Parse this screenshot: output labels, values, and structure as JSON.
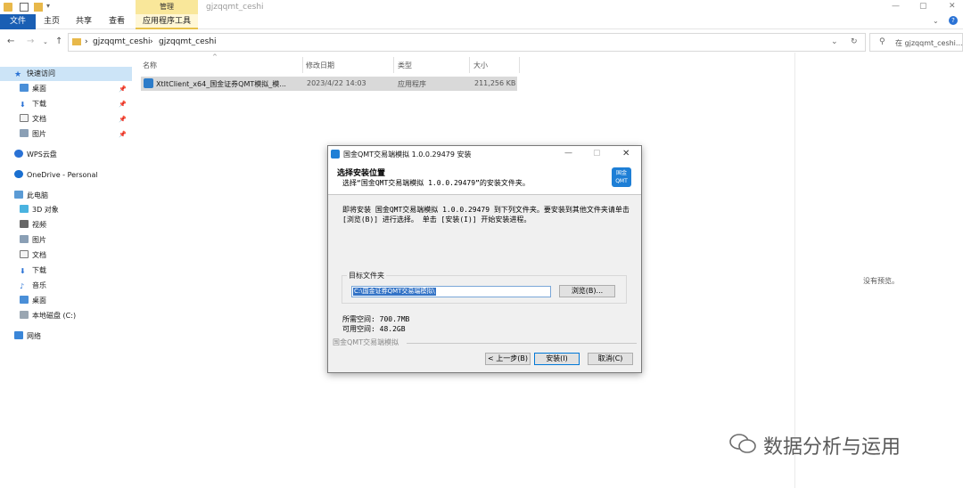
{
  "window": {
    "title": "gjzqqmt_ceshi",
    "tools_group": "管理"
  },
  "ribbon": {
    "tabs": [
      "文件",
      "主页",
      "共享",
      "查看",
      "应用程序工具"
    ]
  },
  "address": {
    "path": [
      "gjzqqmt_ceshi",
      "gjzqqmt_ceshi"
    ],
    "search_placeholder": "在 gjzqqmt_ceshi..."
  },
  "nav": {
    "quick_access": "快速访问",
    "quick_items": [
      "桌面",
      "下载",
      "文档",
      "图片"
    ],
    "wps": "WPS云盘",
    "onedrive": "OneDrive - Personal",
    "this_pc": "此电脑",
    "pc_items": [
      "3D 对象",
      "视频",
      "图片",
      "文档",
      "下载",
      "音乐",
      "桌面",
      "本地磁盘 (C:)"
    ],
    "network": "网络"
  },
  "columns": {
    "name": "名称",
    "date": "修改日期",
    "type": "类型",
    "size": "大小"
  },
  "files": [
    {
      "name": "XtItClient_x64_国金证券QMT模拟_模...",
      "date": "2023/4/22 14:03",
      "type": "应用程序",
      "size": "211,256 KB"
    }
  ],
  "preview": {
    "empty_text": "没有预览。"
  },
  "installer": {
    "title": "国金QMT交易端模拟 1.0.0.29479 安装",
    "heading": "选择安装位置",
    "subheading": "选择“国金QMT交易端模拟 1.0.0.29479”的安装文件夹。",
    "body": "即将安装 国金QMT交易端模拟 1.0.0.29479 到下列文件夹。要安装到其他文件夹请单击 [浏览(B)] 进行选择。 单击 [安装(I)] 开始安装进程。",
    "folder_label": "目标文件夹",
    "folder_path": "C:\\国金证券QMT交易端模拟\\",
    "browse_button": "浏览(B)...",
    "space_required": "所需空间: 700.7MB",
    "space_available": "可用空间: 48.2GB",
    "brand": "国金QMT交易端模拟",
    "back_button": "< 上一步(B)",
    "install_button": "安装(I)",
    "cancel_button": "取消(C)",
    "logo_text": "国金 QMT"
  },
  "watermark": "数据分析与运用",
  "colors": {
    "accent": "#1a5fb4",
    "tools_tab": "#f9e79a",
    "selection": "#3373c6"
  }
}
